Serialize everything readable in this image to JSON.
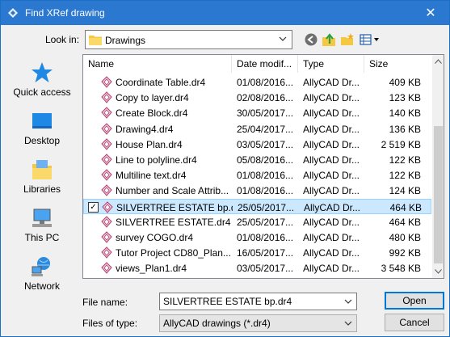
{
  "window": {
    "title": "Find XRef drawing",
    "close_glyph": "✕"
  },
  "lookin": {
    "label": "Look in:",
    "value": "Drawings"
  },
  "toolbar": {
    "icons": [
      "back-icon",
      "up-folder-icon",
      "new-folder-icon",
      "view-menu-icon"
    ]
  },
  "places": [
    {
      "label": "Quick access",
      "icon": "quick-access-star-icon"
    },
    {
      "label": "Desktop",
      "icon": "desktop-icon"
    },
    {
      "label": "Libraries",
      "icon": "libraries-icon"
    },
    {
      "label": "This PC",
      "icon": "this-pc-icon"
    },
    {
      "label": "Network",
      "icon": "network-icon"
    }
  ],
  "columns": {
    "name": "Name",
    "date": "Date modif...",
    "type": "Type",
    "size": "Size"
  },
  "files": [
    {
      "name": "Coordinate Table.dr4",
      "date": "01/08/2016...",
      "type": "AllyCAD Dr...",
      "size": "409 KB"
    },
    {
      "name": "Copy to layer.dr4",
      "date": "02/08/2016...",
      "type": "AllyCAD Dr...",
      "size": "123 KB"
    },
    {
      "name": "Create Block.dr4",
      "date": "30/05/2017...",
      "type": "AllyCAD Dr...",
      "size": "140 KB"
    },
    {
      "name": "Drawing4.dr4",
      "date": "25/04/2017...",
      "type": "AllyCAD Dr...",
      "size": "136 KB"
    },
    {
      "name": "House Plan.dr4",
      "date": "03/05/2017...",
      "type": "AllyCAD Dr...",
      "size": "2 519 KB"
    },
    {
      "name": "Line to polyline.dr4",
      "date": "05/08/2016...",
      "type": "AllyCAD Dr...",
      "size": "122 KB"
    },
    {
      "name": "Multiline text.dr4",
      "date": "01/08/2016...",
      "type": "AllyCAD Dr...",
      "size": "122 KB"
    },
    {
      "name": "Number and Scale Attrib...",
      "date": "01/08/2016...",
      "type": "AllyCAD Dr...",
      "size": "124 KB"
    },
    {
      "name": "SILVERTREE ESTATE bp.dr4",
      "date": "25/05/2017...",
      "type": "AllyCAD Dr...",
      "size": "464 KB",
      "selected": true,
      "check": "✓"
    },
    {
      "name": "SILVERTREE ESTATE.dr4",
      "date": "25/05/2017...",
      "type": "AllyCAD Dr...",
      "size": "464 KB"
    },
    {
      "name": "survey COGO.dr4",
      "date": "01/08/2016...",
      "type": "AllyCAD Dr...",
      "size": "480 KB"
    },
    {
      "name": "Tutor Project CD80_Plan...",
      "date": "16/05/2017...",
      "type": "AllyCAD Dr...",
      "size": "992 KB"
    },
    {
      "name": "views_Plan1.dr4",
      "date": "03/05/2017...",
      "type": "AllyCAD Dr...",
      "size": "3 548 KB"
    }
  ],
  "filename": {
    "label": "File name:",
    "value": "SILVERTREE ESTATE bp.dr4"
  },
  "filetype": {
    "label": "Files of type:",
    "value": "AllyCAD drawings (*.dr4)"
  },
  "buttons": {
    "open": "Open",
    "cancel": "Cancel"
  },
  "colors": {
    "titlebar": "#2b78d0",
    "selection": "#cce8ff",
    "accent": "#0078d7"
  }
}
